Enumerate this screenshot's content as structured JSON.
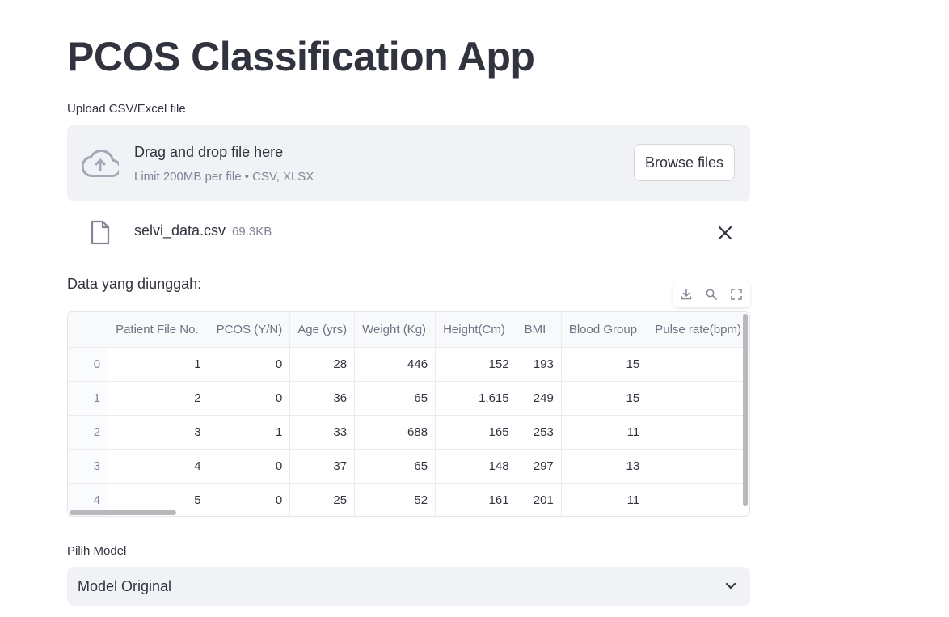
{
  "title": "PCOS Classification App",
  "uploader": {
    "label": "Upload CSV/Excel file",
    "drop_text": "Drag and drop file here",
    "limit_text": "Limit 200MB per file • CSV, XLSX",
    "browse_label": "Browse files"
  },
  "file": {
    "name": "selvi_data.csv",
    "size": "69.3KB"
  },
  "data_label": "Data yang diunggah:",
  "table": {
    "columns": [
      "Patient File No.",
      "PCOS (Y/N)",
      "Age (yrs)",
      "Weight (Kg)",
      "Height(Cm)",
      "BMI",
      "Blood Group",
      "Pulse rate(bpm)"
    ],
    "rows": [
      {
        "index": "0",
        "cells": [
          "1",
          "0",
          "28",
          "446",
          "152",
          "193",
          "15",
          ""
        ]
      },
      {
        "index": "1",
        "cells": [
          "2",
          "0",
          "36",
          "65",
          "1,615",
          "249",
          "15",
          ""
        ]
      },
      {
        "index": "2",
        "cells": [
          "3",
          "1",
          "33",
          "688",
          "165",
          "253",
          "11",
          ""
        ]
      },
      {
        "index": "3",
        "cells": [
          "4",
          "0",
          "37",
          "65",
          "148",
          "297",
          "13",
          ""
        ]
      },
      {
        "index": "4",
        "cells": [
          "5",
          "0",
          "25",
          "52",
          "161",
          "201",
          "11",
          ""
        ]
      }
    ]
  },
  "model_select": {
    "label": "Pilih Model",
    "value": "Model Original"
  },
  "colors": {
    "text": "#31333f",
    "muted": "#808495",
    "panel_bg": "#f0f2f6"
  },
  "icons": [
    "cloud-upload-icon",
    "file-icon",
    "close-icon",
    "download-icon",
    "search-icon",
    "fullscreen-icon",
    "chevron-down-icon"
  ]
}
